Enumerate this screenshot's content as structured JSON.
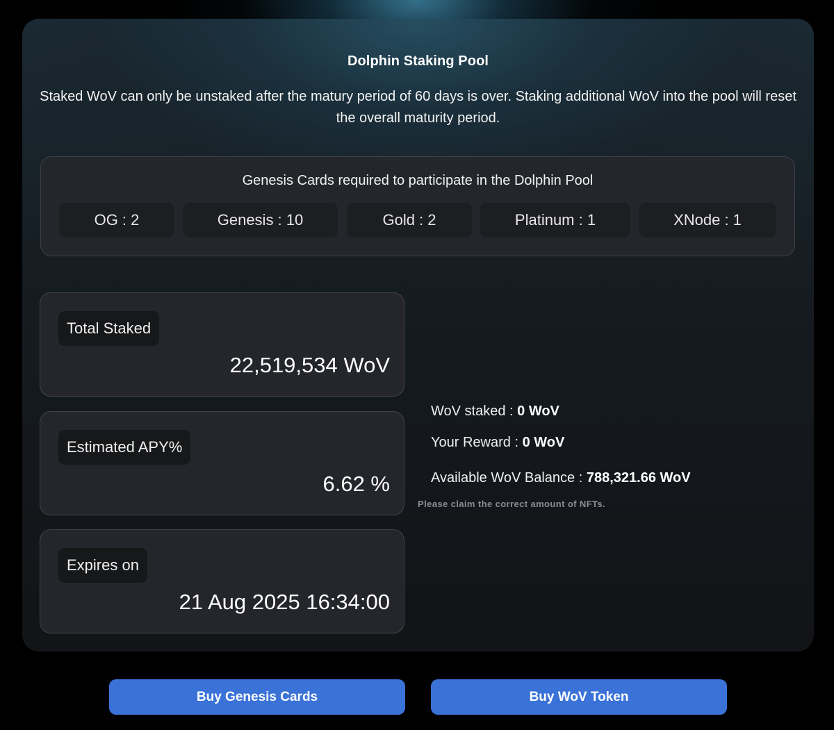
{
  "pool": {
    "title": "Dolphin Staking Pool",
    "description": "Staked WoV can only be unstaked after the matury period of 60 days is over. Staking additional WoV into the pool will reset the overall maturity period."
  },
  "genesis_requirements": {
    "title": "Genesis Cards required to participate in the Dolphin Pool",
    "cards": [
      {
        "label": "OG : 2"
      },
      {
        "label": "Genesis : 10"
      },
      {
        "label": "Gold : 2"
      },
      {
        "label": "Platinum : 1"
      },
      {
        "label": "XNode : 1"
      }
    ]
  },
  "stats": {
    "total_staked": {
      "label": "Total Staked",
      "value": "22,519,534 WoV"
    },
    "apy": {
      "label": "Estimated APY%",
      "value": "6.62 %"
    },
    "expires": {
      "label": "Expires on",
      "value": "21 Aug 2025 16:34:00"
    }
  },
  "user": {
    "wov_staked_label": "WoV staked : ",
    "wov_staked_value": "0 WoV",
    "reward_label": "Your Reward : ",
    "reward_value": "0 WoV",
    "balance_label": "Available WoV Balance : ",
    "balance_value": "788,321.66 WoV",
    "warning": "Please claim the correct amount of NFTs."
  },
  "buttons": {
    "buy_genesis": "Buy Genesis Cards",
    "buy_wov": "Buy WoV Token"
  },
  "colors": {
    "accent_button": "#3a72d8",
    "background": "#000000",
    "card": "#24262c"
  }
}
